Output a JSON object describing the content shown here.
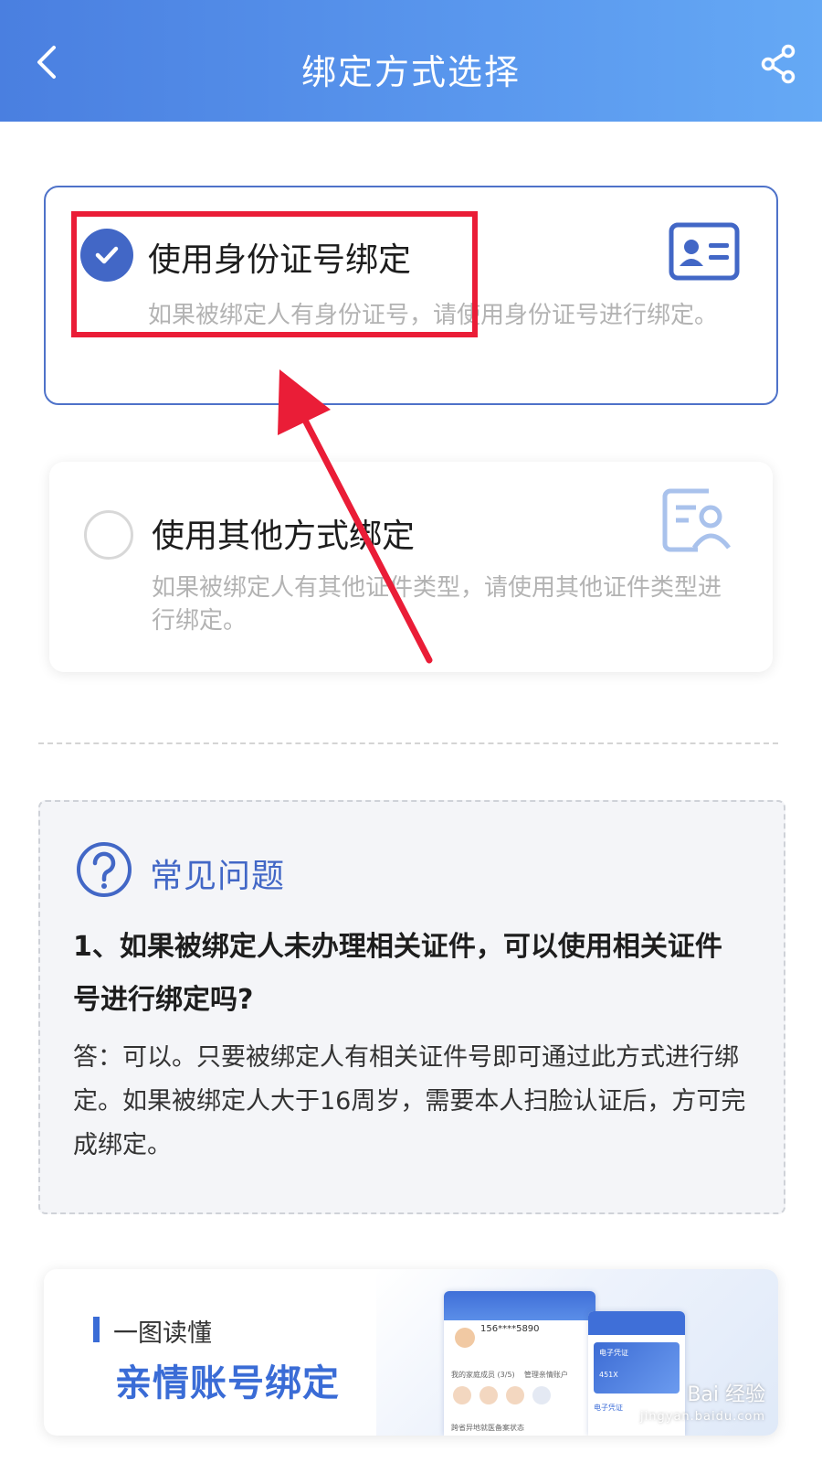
{
  "header": {
    "title": "绑定方式选择",
    "back_icon": "chevron-left-icon",
    "share_icon": "share-icon"
  },
  "options": [
    {
      "title": "使用身份证号绑定",
      "description": "如果被绑定人有身份证号，请使用身份证号进行绑定。",
      "selected": true,
      "icon": "id-card-icon"
    },
    {
      "title": "使用其他方式绑定",
      "description": "如果被绑定人有其他证件类型，请使用其他证件类型进行绑定。",
      "selected": false,
      "icon": "document-person-icon"
    }
  ],
  "faq": {
    "icon": "question-circle-icon",
    "title": "常见问题",
    "question": "1、如果被绑定人未办理相关证件，可以使用相关证件号进行绑定吗?",
    "answer": "答：可以。只要被绑定人有相关证件号即可通过此方式进行绑定。如果被绑定人大于16周岁，需要本人扫脸认证后，方可完成绑定。"
  },
  "banner": {
    "subtitle": "一图读懂",
    "title": "亲情账号绑定",
    "mock": {
      "phone_number": "156****5890",
      "members_label": "我的家庭成员",
      "members_count": "(3/5)",
      "manage_label": "管理亲情账户",
      "footer_label": "跨省异地就医备案状态",
      "card_label": "电子凭证",
      "card_suffix": "451X",
      "card_footer": "电子凭证"
    }
  },
  "watermark": {
    "text": "Bai 经验",
    "url": "jingyan.baidu.com"
  },
  "colors": {
    "header_gradient_start": "#4a7fe0",
    "header_gradient_end": "#65a9f5",
    "accent_blue": "#4267c6",
    "annotation_red": "#ea1d37"
  }
}
